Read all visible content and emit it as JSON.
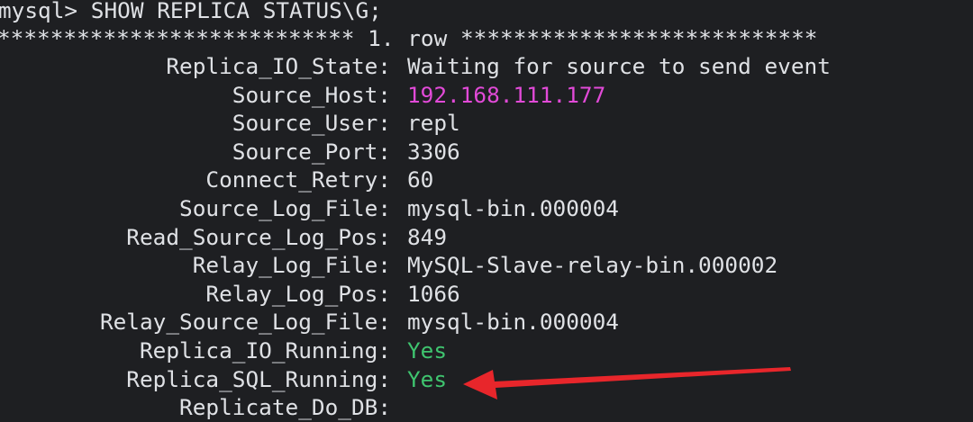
{
  "terminal": {
    "command_line": "mysql> SHOW REPLICA STATUS\\G;",
    "row_separator": "*************************** 1. row ***************************",
    "fields": [
      {
        "label": "Replica_IO_State:",
        "value": "Waiting for source to send event",
        "color": "#dfe1e5"
      },
      {
        "label": "Source_Host:",
        "value": "192.168.111.177",
        "color": "#e24ad8"
      },
      {
        "label": "Source_User:",
        "value": "repl",
        "color": "#dfe1e5"
      },
      {
        "label": "Source_Port:",
        "value": "3306",
        "color": "#dfe1e5"
      },
      {
        "label": "Connect_Retry:",
        "value": "60",
        "color": "#dfe1e5"
      },
      {
        "label": "Source_Log_File:",
        "value": "mysql-bin.000004",
        "color": "#dfe1e5"
      },
      {
        "label": "Read_Source_Log_Pos:",
        "value": "849",
        "color": "#dfe1e5"
      },
      {
        "label": "Relay_Log_File:",
        "value": "MySQL-Slave-relay-bin.000002",
        "color": "#dfe1e5"
      },
      {
        "label": "Relay_Log_Pos:",
        "value": "1066",
        "color": "#dfe1e5"
      },
      {
        "label": "Relay_Source_Log_File:",
        "value": "mysql-bin.000004",
        "color": "#dfe1e5"
      },
      {
        "label": "Replica_IO_Running:",
        "value": "Yes",
        "color": "#3fc46f"
      },
      {
        "label": "Replica_SQL_Running:",
        "value": "Yes",
        "color": "#3fc46f"
      },
      {
        "label": "Replicate_Do_DB:",
        "value": "",
        "color": "#dfe1e5"
      }
    ]
  },
  "annotation": {
    "icon": "red-arrow-icon",
    "color": "#e8262b",
    "points_to": "Replica_SQL_Running"
  },
  "colors": {
    "background": "#1e1f22",
    "text": "#dfe1e5",
    "ip_highlight": "#e24ad8",
    "yes_highlight": "#3fc46f"
  }
}
